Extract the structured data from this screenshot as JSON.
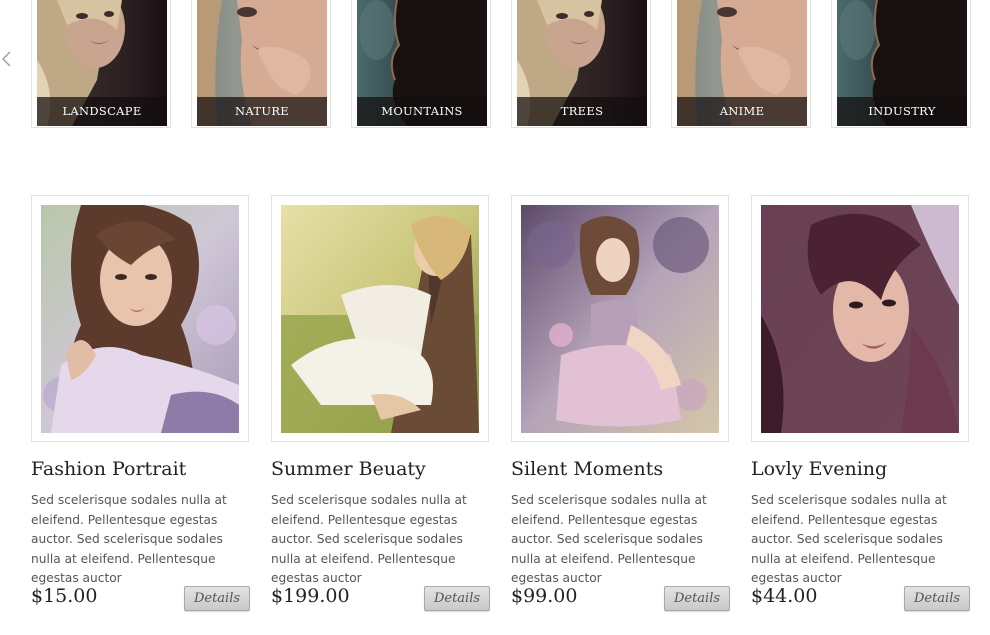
{
  "carousel": {
    "categories": [
      {
        "label": "LANDSCAPE"
      },
      {
        "label": "NATURE"
      },
      {
        "label": "MOUNTAINS"
      },
      {
        "label": "TREES"
      },
      {
        "label": "ANIME"
      },
      {
        "label": "INDUSTRY"
      }
    ],
    "prev_icon": "chevron-left-icon"
  },
  "products": [
    {
      "title": "Fashion Portrait",
      "description": "Sed scelerisque sodales nulla at eleifend. Pellentesque egestas auctor. Sed scelerisque sodales nulla at eleifend. Pellentesque egestas auctor",
      "price": "$15.00",
      "details_label": "Details"
    },
    {
      "title": "Summer Beuaty",
      "description": "Sed scelerisque sodales nulla at eleifend. Pellentesque egestas auctor. Sed scelerisque sodales nulla at eleifend. Pellentesque egestas auctor",
      "price": "$199.00",
      "details_label": "Details"
    },
    {
      "title": "Silent Moments",
      "description": "Sed scelerisque sodales nulla at eleifend. Pellentesque egestas auctor. Sed scelerisque sodales nulla at eleifend. Pellentesque egestas auctor",
      "price": "$99.00",
      "details_label": "Details"
    },
    {
      "title": "Lovly Evening",
      "description": "Sed scelerisque sodales nulla at eleifend. Pellentesque egestas auctor. Sed scelerisque sodales nulla at eleifend. Pellentesque egestas auctor",
      "price": "$44.00",
      "details_label": "Details"
    }
  ],
  "colors": {
    "label_overlay": "#140e0e",
    "text_dark": "#222222",
    "text_body": "#555555",
    "border": "#e2e2e2"
  }
}
